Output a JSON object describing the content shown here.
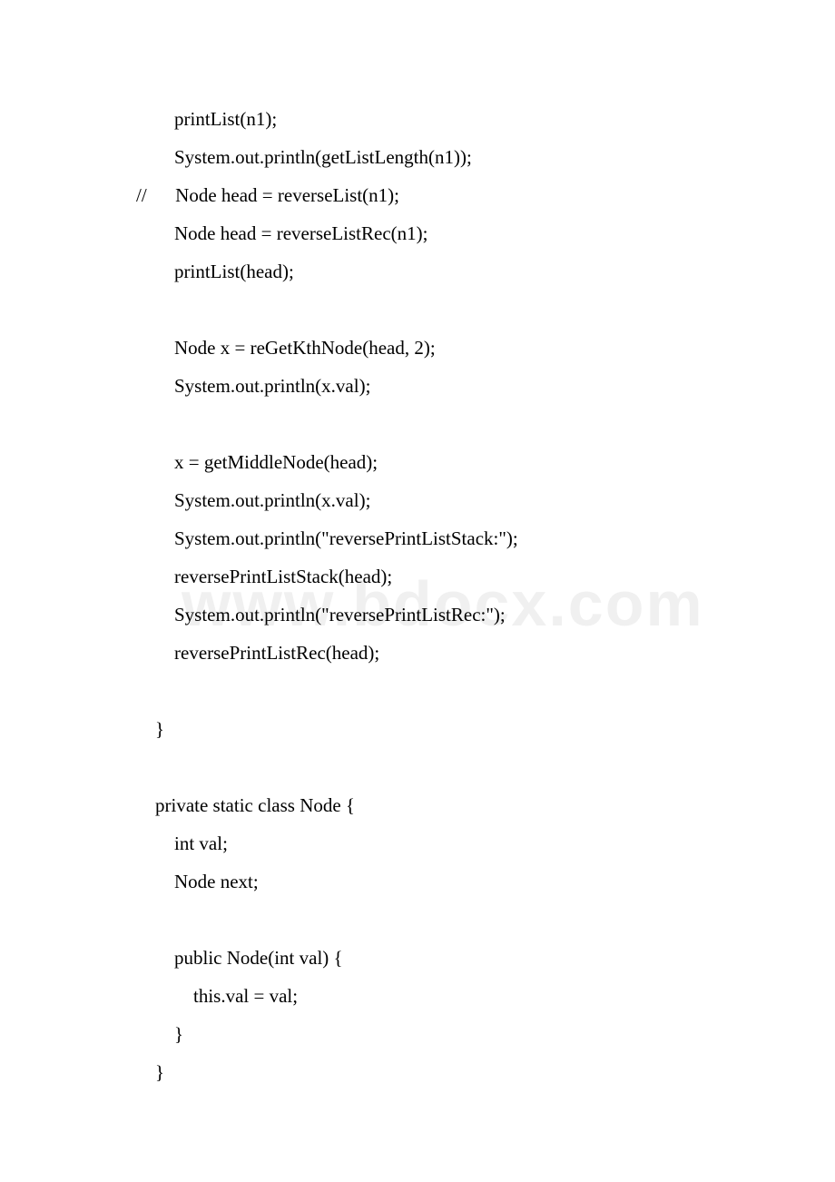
{
  "watermark": "www.bdocx.com",
  "code": {
    "lines": [
      "        printList(n1);  ",
      "        System.out.println(getListLength(n1));  ",
      "//      Node head = reverseList(n1);  ",
      "        Node head = reverseListRec(n1);  ",
      "        printList(head);  ",
      "          ",
      "        Node x = reGetKthNode(head, 2);  ",
      "        System.out.println(x.val);  ",
      "          ",
      "        x = getMiddleNode(head);  ",
      "        System.out.println(x.val);  ",
      "        System.out.println(\"reversePrintListStack:\");  ",
      "        reversePrintListStack(head);  ",
      "        System.out.println(\"reversePrintListRec:\");  ",
      "        reversePrintListRec(head);  ",
      "          ",
      "    }  ",
      "  ",
      "    private static class Node {  ",
      "        int val;  ",
      "        Node next;  ",
      "  ",
      "        public Node(int val) {  ",
      "            this.val = val;  ",
      "        }  ",
      "    }  "
    ]
  }
}
